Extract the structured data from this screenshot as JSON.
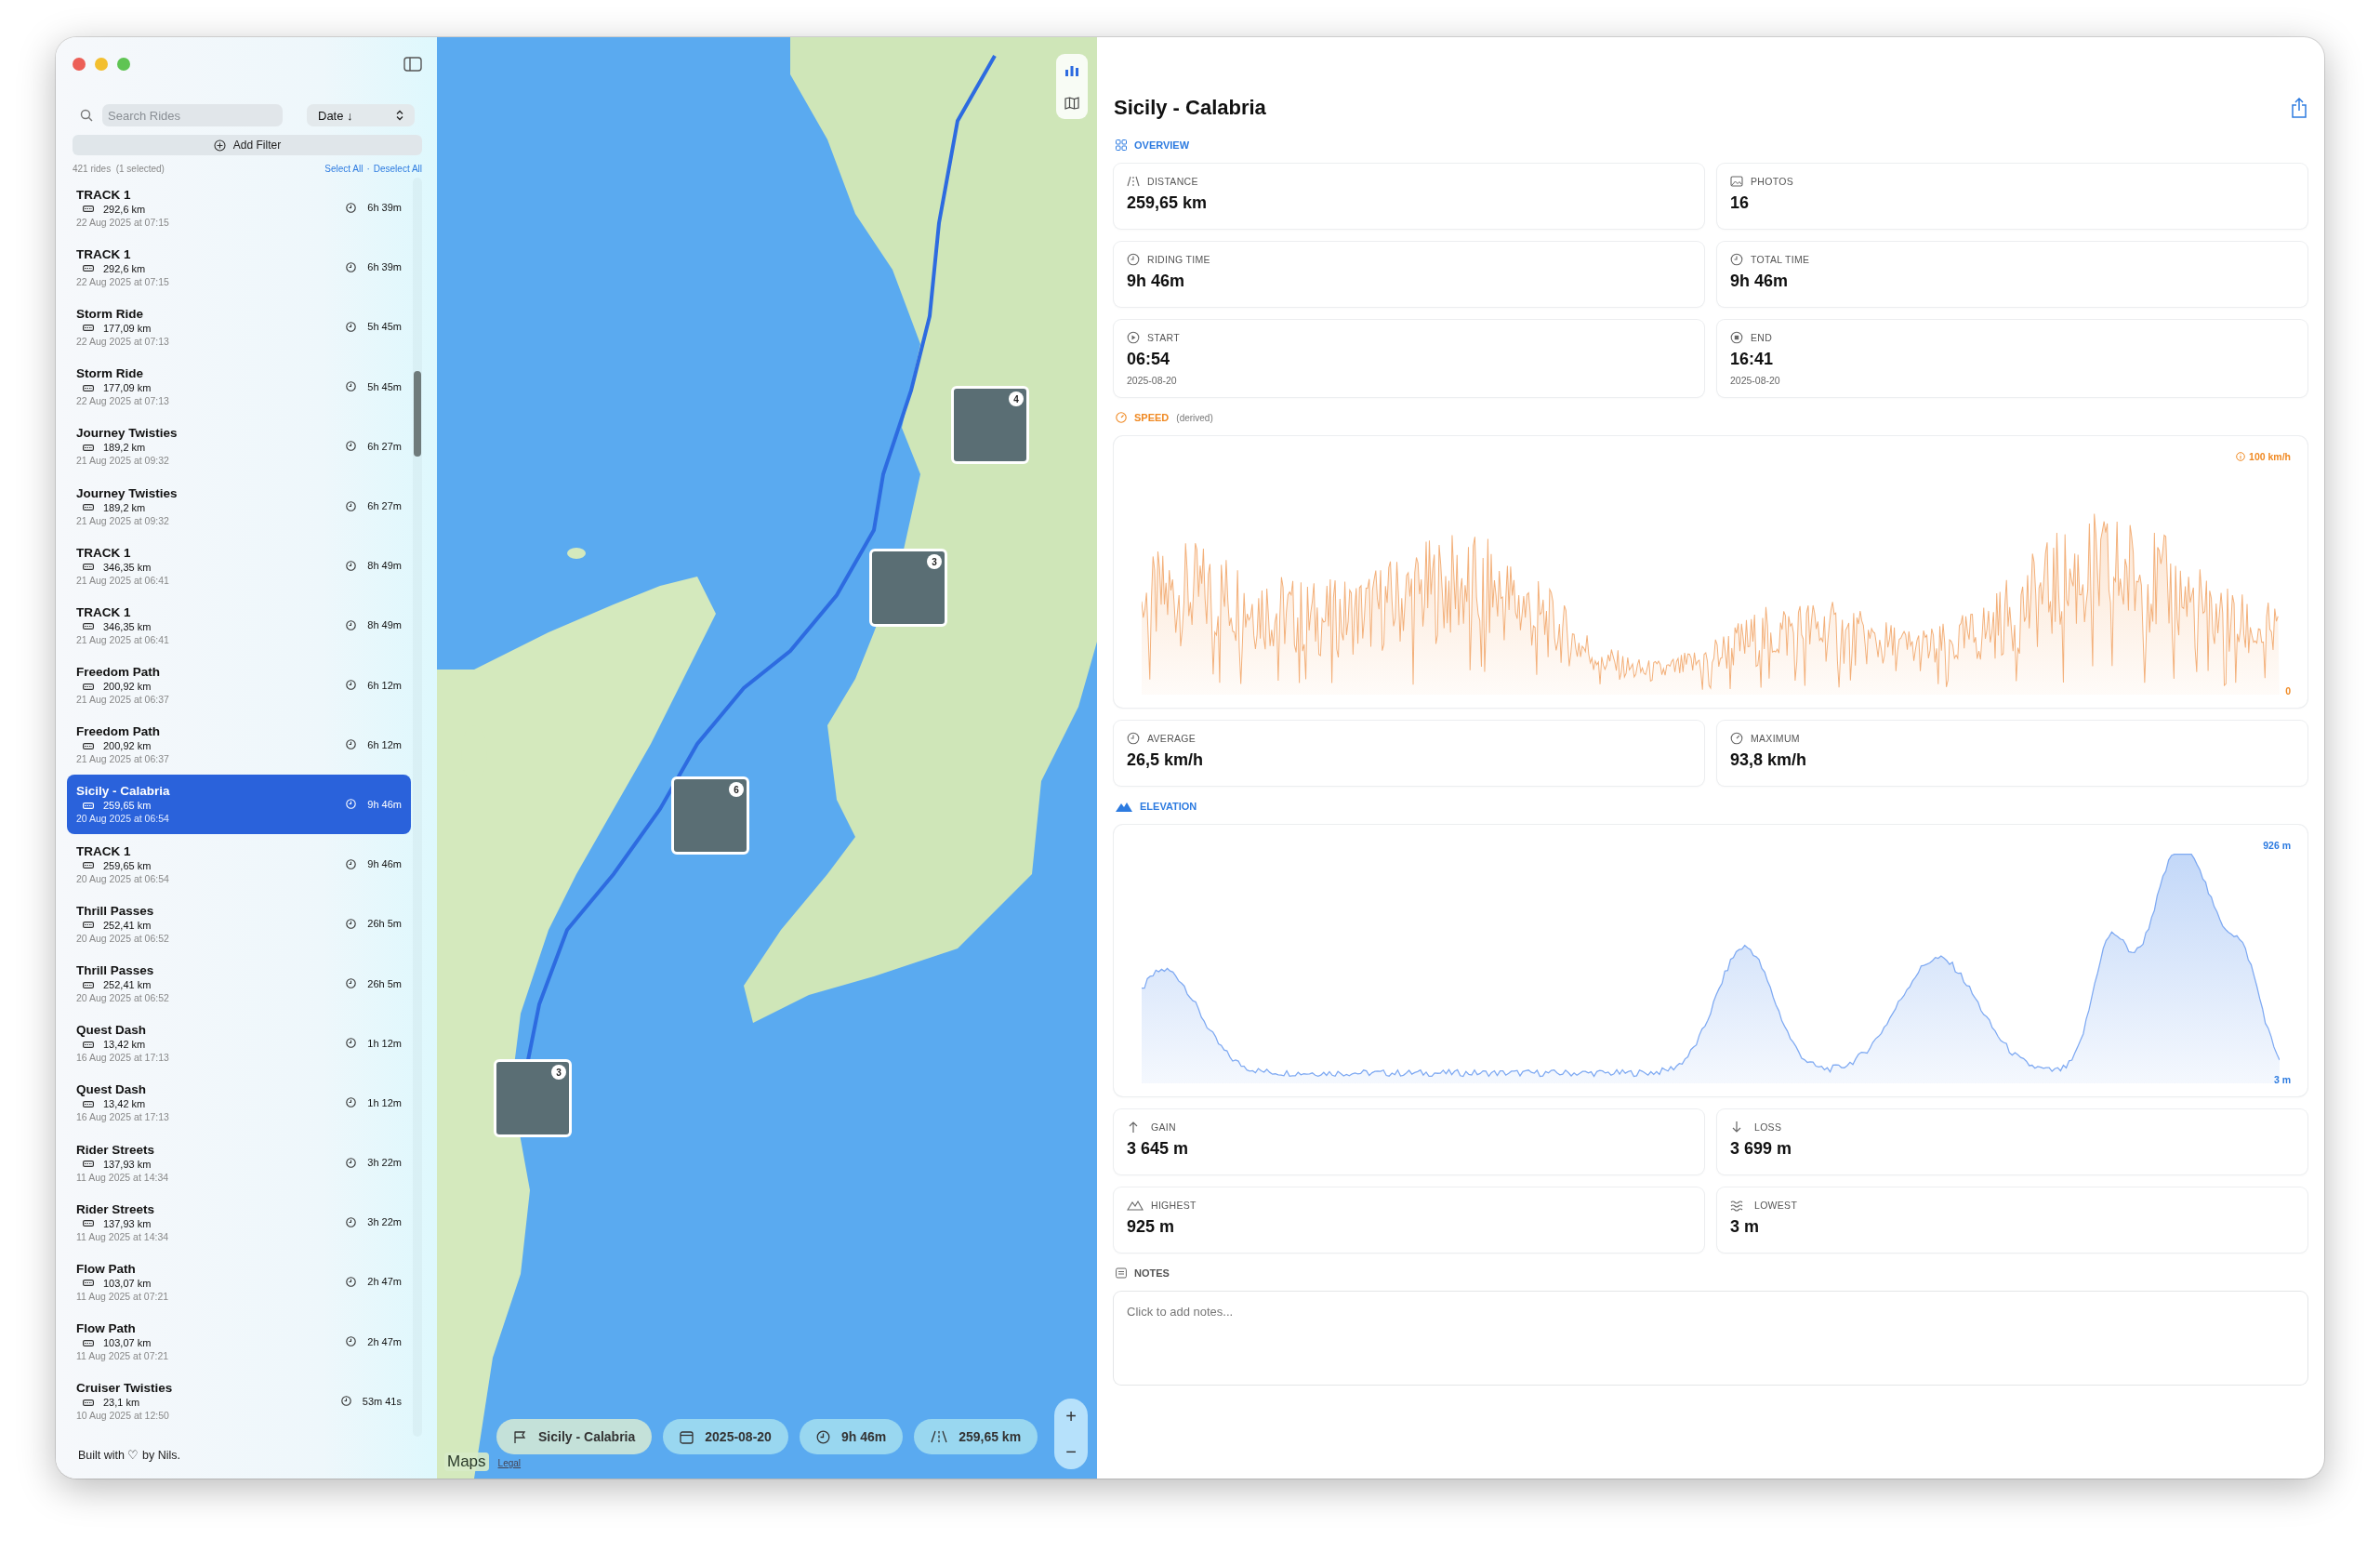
{
  "sidebar": {
    "search": {
      "placeholder": "Search Rides"
    },
    "sort": "Date ↓",
    "add_filter": "Add Filter",
    "count": "421 rides  (1 selected)",
    "select_all": "Select All",
    "separator": "·",
    "deselect_all": "Deselect All",
    "rides": [
      {
        "name": "TRACK 1",
        "distance": "292,6 km",
        "date": "22 Aug 2025 at 07:15",
        "duration": "6h 39m",
        "selected": false
      },
      {
        "name": "TRACK 1",
        "distance": "292,6 km",
        "date": "22 Aug 2025 at 07:15",
        "duration": "6h 39m",
        "selected": false
      },
      {
        "name": "Storm Ride",
        "distance": "177,09 km",
        "date": "22 Aug 2025 at 07:13",
        "duration": "5h 45m",
        "selected": false
      },
      {
        "name": "Storm Ride",
        "distance": "177,09 km",
        "date": "22 Aug 2025 at 07:13",
        "duration": "5h 45m",
        "selected": false
      },
      {
        "name": "Journey Twisties",
        "distance": "189,2 km",
        "date": "21 Aug 2025 at 09:32",
        "duration": "6h 27m",
        "selected": false
      },
      {
        "name": "Journey Twisties",
        "distance": "189,2 km",
        "date": "21 Aug 2025 at 09:32",
        "duration": "6h 27m",
        "selected": false
      },
      {
        "name": "TRACK 1",
        "distance": "346,35 km",
        "date": "21 Aug 2025 at 06:41",
        "duration": "8h 49m",
        "selected": false
      },
      {
        "name": "TRACK 1",
        "distance": "346,35 km",
        "date": "21 Aug 2025 at 06:41",
        "duration": "8h 49m",
        "selected": false
      },
      {
        "name": "Freedom Path",
        "distance": "200,92 km",
        "date": "21 Aug 2025 at 06:37",
        "duration": "6h 12m",
        "selected": false
      },
      {
        "name": "Freedom Path",
        "distance": "200,92 km",
        "date": "21 Aug 2025 at 06:37",
        "duration": "6h 12m",
        "selected": false
      },
      {
        "name": "Sicily - Calabria",
        "distance": "259,65 km",
        "date": "20 Aug 2025 at 06:54",
        "duration": "9h 46m",
        "selected": true
      },
      {
        "name": "TRACK 1",
        "distance": "259,65 km",
        "date": "20 Aug 2025 at 06:54",
        "duration": "9h 46m",
        "selected": false
      },
      {
        "name": "Thrill Passes",
        "distance": "252,41 km",
        "date": "20 Aug 2025 at 06:52",
        "duration": "26h 5m",
        "selected": false
      },
      {
        "name": "Thrill Passes",
        "distance": "252,41 km",
        "date": "20 Aug 2025 at 06:52",
        "duration": "26h 5m",
        "selected": false
      },
      {
        "name": "Quest Dash",
        "distance": "13,42 km",
        "date": "16 Aug 2025 at 17:13",
        "duration": "1h 12m",
        "selected": false
      },
      {
        "name": "Quest Dash",
        "distance": "13,42 km",
        "date": "16 Aug 2025 at 17:13",
        "duration": "1h 12m",
        "selected": false
      },
      {
        "name": "Rider Streets",
        "distance": "137,93 km",
        "date": "11 Aug 2025 at 14:34",
        "duration": "3h 22m",
        "selected": false
      },
      {
        "name": "Rider Streets",
        "distance": "137,93 km",
        "date": "11 Aug 2025 at 14:34",
        "duration": "3h 22m",
        "selected": false
      },
      {
        "name": "Flow Path",
        "distance": "103,07 km",
        "date": "11 Aug 2025 at 07:21",
        "duration": "2h 47m",
        "selected": false
      },
      {
        "name": "Flow Path",
        "distance": "103,07 km",
        "date": "11 Aug 2025 at 07:21",
        "duration": "2h 47m",
        "selected": false
      },
      {
        "name": "Cruiser Twisties",
        "distance": "23,1 km",
        "date": "10 Aug 2025 at 12:50",
        "duration": "53m 41s",
        "selected": false
      }
    ],
    "footer": "Built with ♡ by Nils."
  },
  "map": {
    "photo_pins": [
      {
        "count": "4"
      },
      {
        "count": "3"
      },
      {
        "count": "6"
      },
      {
        "count": "3"
      }
    ],
    "pills": [
      {
        "kind": "route",
        "label": "Sicily - Calabria"
      },
      {
        "kind": "date",
        "label": "2025-08-20"
      },
      {
        "kind": "time",
        "label": "9h 46m"
      },
      {
        "kind": "distance",
        "label": "259,65 km"
      }
    ],
    "zoom_in": "+",
    "zoom_out": "−",
    "logo": "Maps",
    "legal": "Legal"
  },
  "detail": {
    "title": "Sicily - Calabria",
    "overview_label": "OVERVIEW",
    "overview_cards": [
      {
        "kind": "distance",
        "label": "DISTANCE",
        "value": "259,65 km"
      },
      {
        "kind": "photos",
        "label": "PHOTOS",
        "value": "16"
      },
      {
        "kind": "clock",
        "label": "RIDING TIME",
        "value": "9h 46m"
      },
      {
        "kind": "total",
        "label": "TOTAL TIME",
        "value": "9h 46m"
      },
      {
        "kind": "start",
        "label": "START",
        "value": "06:54",
        "sub": "2025-08-20"
      },
      {
        "kind": "end",
        "label": "END",
        "value": "16:41",
        "sub": "2025-08-20"
      }
    ],
    "speed_label": "SPEED",
    "speed_note": "(derived)",
    "speed_max": "100 km/h",
    "speed_min": "0",
    "speed_cards": [
      {
        "kind": "average",
        "label": "AVERAGE",
        "value": "26,5 km/h"
      },
      {
        "kind": "gauge",
        "label": "MAXIMUM",
        "value": "93,8 km/h"
      }
    ],
    "elevation_label": "ELEVATION",
    "elevation_max": "926 m",
    "elevation_min": "3 m",
    "elevation_cards": [
      {
        "kind": "up",
        "label": "GAIN",
        "value": "3 645 m"
      },
      {
        "kind": "down",
        "label": "LOSS",
        "value": "3 699 m"
      },
      {
        "kind": "mountain",
        "label": "HIGHEST",
        "value": "925 m"
      },
      {
        "kind": "water",
        "label": "LOWEST",
        "value": "3 m"
      }
    ],
    "notes_label": "NOTES",
    "notes_placeholder": "Click to add notes..."
  }
}
